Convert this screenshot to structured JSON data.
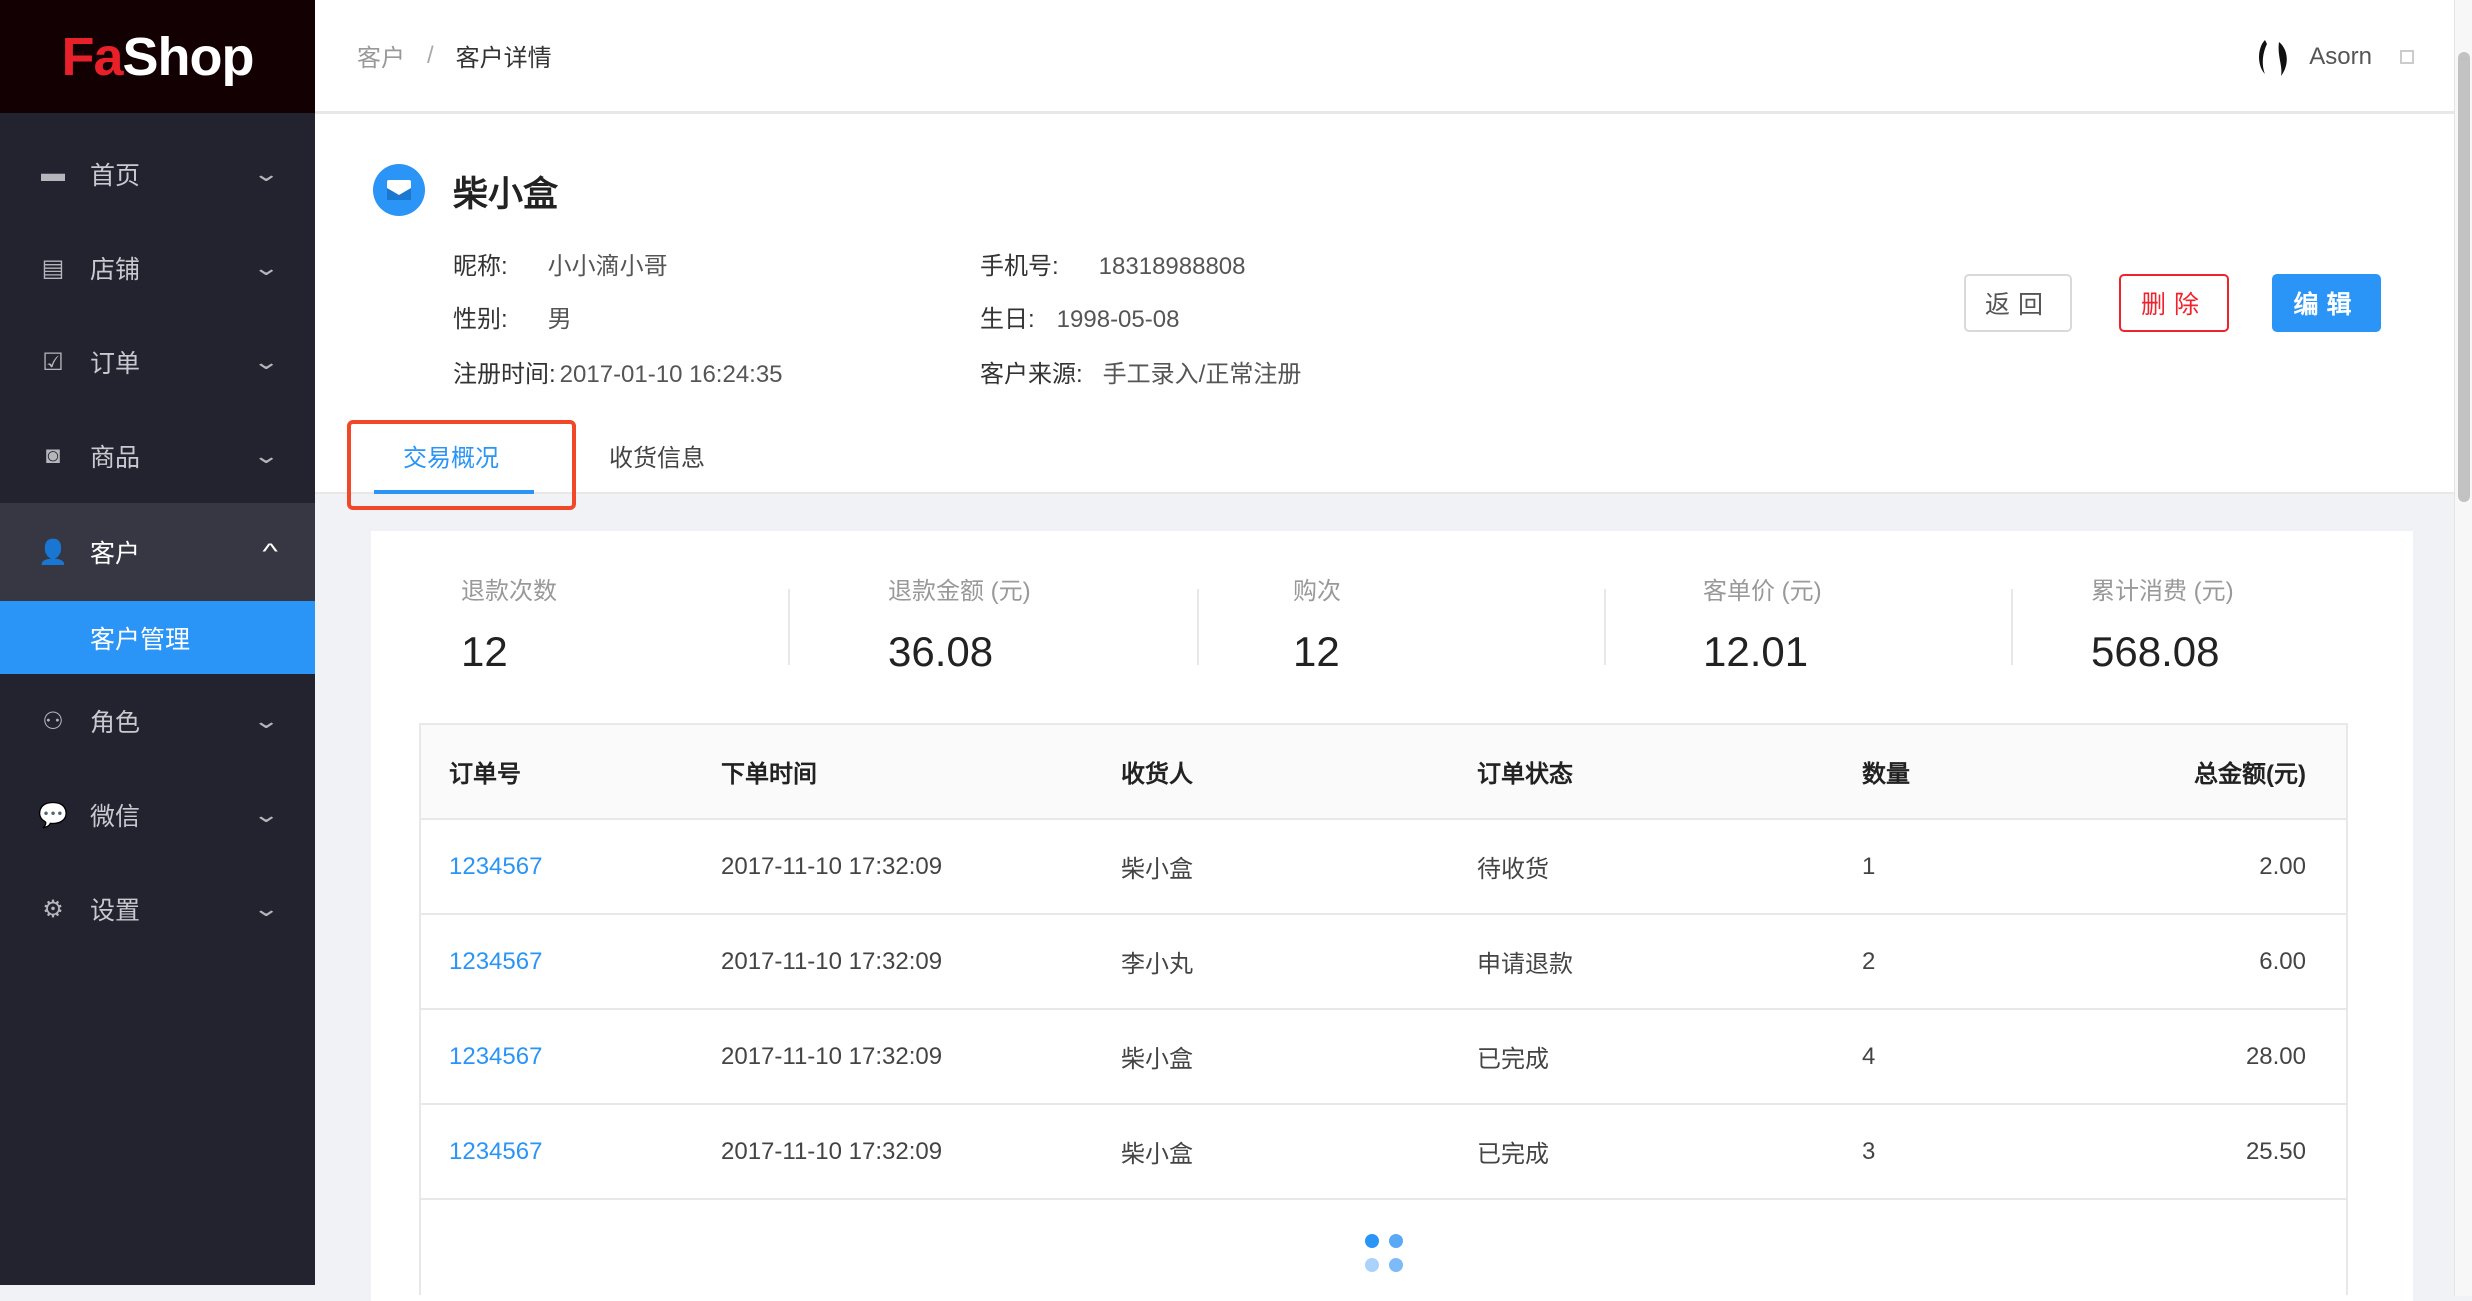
{
  "brand": {
    "logo_red": "Fa",
    "logo_white": "Shop"
  },
  "sidebar": {
    "items": [
      {
        "label": "首页",
        "icon": "monitor-icon"
      },
      {
        "label": "店铺",
        "icon": "store-icon"
      },
      {
        "label": "订单",
        "icon": "clipboard-check-icon"
      },
      {
        "label": "商品",
        "icon": "shopping-bag-icon"
      },
      {
        "label": "客户",
        "icon": "user-icon",
        "expanded": true,
        "children": [
          {
            "label": "客户管理",
            "active": true
          }
        ]
      },
      {
        "label": "角色",
        "icon": "user-settings-icon"
      },
      {
        "label": "微信",
        "icon": "wechat-icon"
      },
      {
        "label": "设置",
        "icon": "gear-icon"
      }
    ]
  },
  "header": {
    "breadcrumb": [
      "客户",
      "客户详情"
    ],
    "separator": "/",
    "username": "Asorn"
  },
  "profile": {
    "name": "柴小盒",
    "fields": {
      "nickname_label": "昵称:",
      "nickname": "小小滴小哥",
      "gender_label": "性别:",
      "gender": "男",
      "register_label": "注册时间:",
      "register": "2017-01-10 16:24:35",
      "phone_label": "手机号:",
      "phone": "18318988808",
      "birthday_label": "生日:",
      "birthday": "1998-05-08",
      "source_label": "客户来源:",
      "source": "手工录入/正常注册"
    },
    "buttons": {
      "back": "返回",
      "delete": "删除",
      "edit": "编辑"
    }
  },
  "tabs": [
    {
      "label": "交易概况",
      "active": true
    },
    {
      "label": "收货信息"
    }
  ],
  "stats": [
    {
      "label": "退款次数",
      "value": "12"
    },
    {
      "label": "退款金额 (元)",
      "value": "36.08"
    },
    {
      "label": "购次",
      "value": "12"
    },
    {
      "label": "客单价 (元)",
      "value": "12.01"
    },
    {
      "label": "累计消费 (元)",
      "value": "568.08"
    }
  ],
  "table": {
    "headers": [
      "订单号",
      "下单时间",
      "收货人",
      "订单状态",
      "数量",
      "总金额(元)"
    ],
    "rows": [
      [
        "1234567",
        "2017-11-10 17:32:09",
        "柴小盒",
        "待收货",
        "1",
        "2.00"
      ],
      [
        "1234567",
        "2017-11-10 17:32:09",
        "李小丸",
        "申请退款",
        "2",
        "6.00"
      ],
      [
        "1234567",
        "2017-11-10 17:32:09",
        "柴小盒",
        "已完成",
        "4",
        "28.00"
      ],
      [
        "1234567",
        "2017-11-10 17:32:09",
        "柴小盒",
        "已完成",
        "3",
        "25.50"
      ]
    ]
  },
  "colors": {
    "accent": "#2a94f7",
    "danger": "#f0232d",
    "sidebar": "#22232f",
    "highlight": "#f2482a"
  }
}
